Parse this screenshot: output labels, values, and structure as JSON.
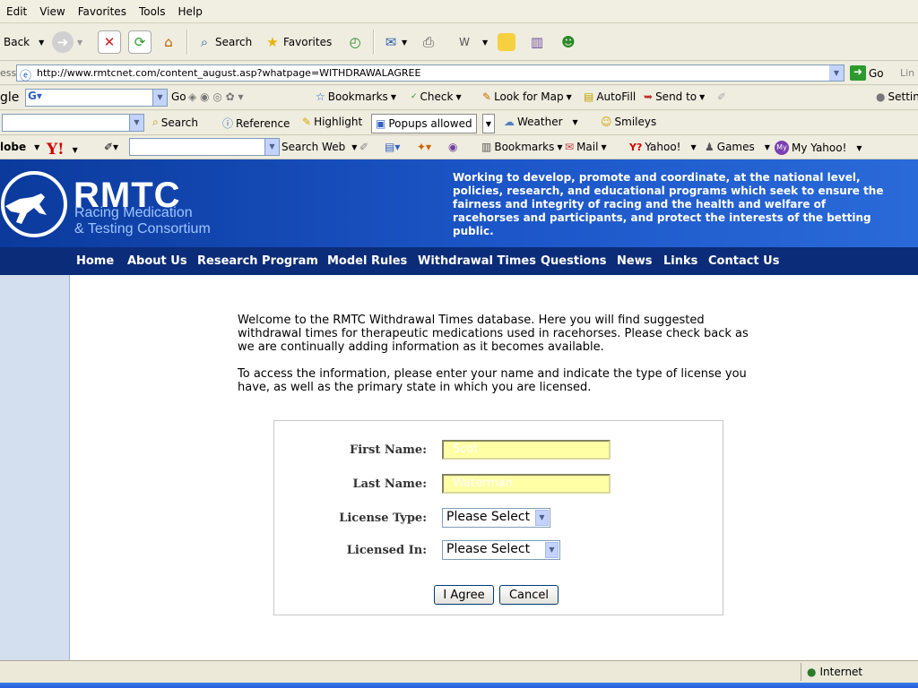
{
  "menu": [
    "Edit",
    "View",
    "Favorites",
    "Tools",
    "Help"
  ],
  "toolbar": {
    "back": "Back",
    "search": "Search",
    "favorites": "Favorites"
  },
  "address": {
    "label": "ess",
    "url": "http://www.rmtcnet.com/content_august.asp?whatpage=WITHDRAWALAGREE",
    "go": "Go",
    "links": "Lin"
  },
  "google_bar": {
    "brand": "gle",
    "go": "Go",
    "bookmarks": "Bookmarks",
    "check": "Check",
    "lookformap": "Look for Map",
    "autofill": "AutoFill",
    "sendto": "Send to",
    "settings": "Settin"
  },
  "bar3": {
    "search": "Search",
    "reference": "Reference",
    "highlight": "Highlight",
    "popups": "Popups allowed",
    "weather": "Weather",
    "smileys": "Smileys"
  },
  "yahoo_bar": {
    "brand": "lobe",
    "searchweb": "Search Web",
    "bookmarks": "Bookmarks",
    "mail": "Mail",
    "yahoo": "Yahoo!",
    "games": "Games",
    "myyahoo": "My Yahoo!"
  },
  "site": {
    "logo": "RMTC",
    "logo_line1": "Racing Medication",
    "logo_line2": "& Testing Consortium",
    "mission": "Working to develop, promote and coordinate, at the national level, policies, research, and educational programs which seek to ensure the fairness and integrity of racing and the health and welfare of racehorses and participants, and protect the interests of the betting public.",
    "nav": [
      "Home",
      "About Us",
      "Research Program",
      "Model Rules",
      "Withdrawal Times",
      "Questions",
      "News",
      "Links",
      "Contact Us"
    ]
  },
  "content": {
    "intro1": "Welcome to the RMTC Withdrawal Times database. Here you will find suggested withdrawal times for therapeutic medications used in racehorses. Please check back as we are continually adding information as it becomes available.",
    "intro2": "To access the information, please enter your name and indicate the type of license you have, as well as the primary state in which you are licensed."
  },
  "form": {
    "first_label": "First Name:",
    "first_value": "Scot",
    "last_label": "Last Name:",
    "last_value": "Waterman",
    "license_type_label": "License Type:",
    "license_type_value": "Please Select",
    "licensed_in_label": "Licensed In:",
    "licensed_in_value": "Please Select",
    "agree": "I Agree",
    "cancel": "Cancel"
  },
  "status": {
    "zone": "Internet"
  }
}
